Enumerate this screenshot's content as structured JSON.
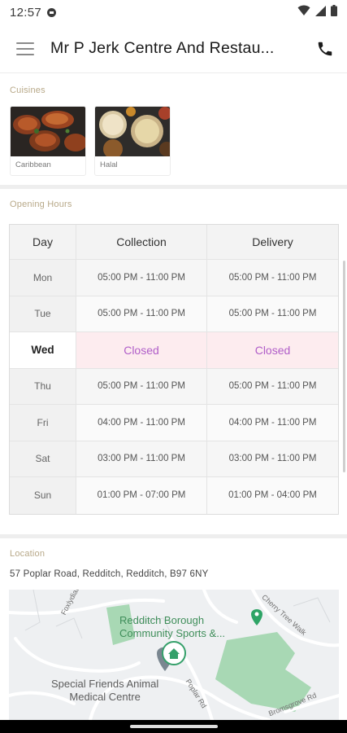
{
  "status_bar": {
    "time": "12:57"
  },
  "app_bar": {
    "title": "Mr P Jerk Centre And Restau..."
  },
  "cuisines": {
    "label": "Cuisines",
    "items": [
      {
        "name": "Caribbean"
      },
      {
        "name": "Halal"
      }
    ]
  },
  "opening_hours": {
    "label": "Opening Hours",
    "headers": {
      "day": "Day",
      "collection": "Collection",
      "delivery": "Delivery"
    },
    "rows": [
      {
        "day": "Mon",
        "collection": "05:00 PM - 11:00 PM",
        "delivery": "05:00 PM - 11:00 PM"
      },
      {
        "day": "Tue",
        "collection": "05:00 PM - 11:00 PM",
        "delivery": "05:00 PM - 11:00 PM"
      },
      {
        "day": "Wed",
        "collection": "Closed",
        "delivery": "Closed"
      },
      {
        "day": "Thu",
        "collection": "05:00 PM - 11:00 PM",
        "delivery": "05:00 PM - 11:00 PM"
      },
      {
        "day": "Fri",
        "collection": "04:00 PM - 11:00 PM",
        "delivery": "04:00 PM - 11:00 PM"
      },
      {
        "day": "Sat",
        "collection": "03:00 PM - 11:00 PM",
        "delivery": "03:00 PM - 11:00 PM"
      },
      {
        "day": "Sun",
        "collection": "01:00 PM - 07:00 PM",
        "delivery": "01:00 PM - 04:00 PM"
      }
    ]
  },
  "location": {
    "label": "Location",
    "address": "57 Poplar Road, Redditch, Redditch, B97 6NY",
    "map": {
      "place_green": "Redditch Borough\nCommunity Sports &...",
      "place_grey": "Special Friends Animal\nMedical Centre",
      "roads": [
        "Foxlydiate Cres",
        "Poplar Rd",
        "Cherry Tree Walk",
        "Bromsgrove Rd"
      ]
    }
  },
  "colors": {
    "accent": "#b05ec9",
    "section_label": "#b8a989",
    "closed_bg": "#fdecef",
    "map_park": "#a8d8b4"
  }
}
